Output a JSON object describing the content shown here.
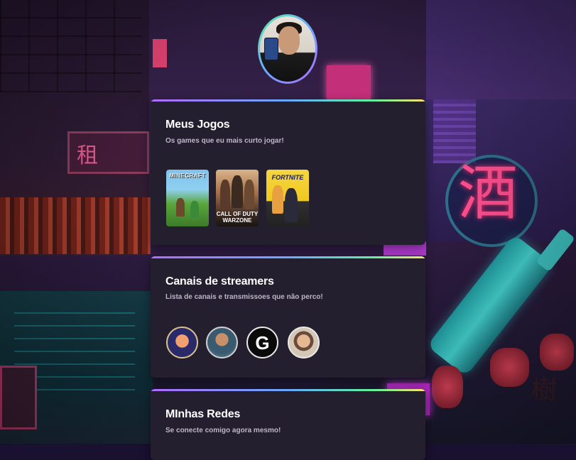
{
  "profile": {
    "avatar_name": "profile-photo"
  },
  "cards": [
    {
      "title": "Meus Jogos",
      "subtitle": "Os games que eu mais curto jogar!",
      "games": [
        {
          "label": "MINECRAFT"
        },
        {
          "label": "CALL OF DUTY WARZONE"
        },
        {
          "label": "FORTNITE"
        }
      ]
    },
    {
      "title": "Canais de streamers",
      "subtitle": "Lista de canais e transmissoes que não perco!",
      "streamers": [
        {
          "icon": "streamer-avatar-1"
        },
        {
          "icon": "streamer-avatar-2"
        },
        {
          "icon": "streamer-avatar-3",
          "glyph": "G"
        },
        {
          "icon": "streamer-avatar-4"
        }
      ]
    },
    {
      "title": "MInhas Redes",
      "subtitle": "Se conecte comigo agora mesmo!"
    }
  ],
  "background": {
    "sign_left": "租",
    "sign_circle": "酒",
    "sign_right": "樹"
  },
  "colors": {
    "card_bg": "#241f2e",
    "gradient": [
      "#b06cff",
      "#6aa8ff",
      "#5ef0a0",
      "#ffe070"
    ]
  }
}
